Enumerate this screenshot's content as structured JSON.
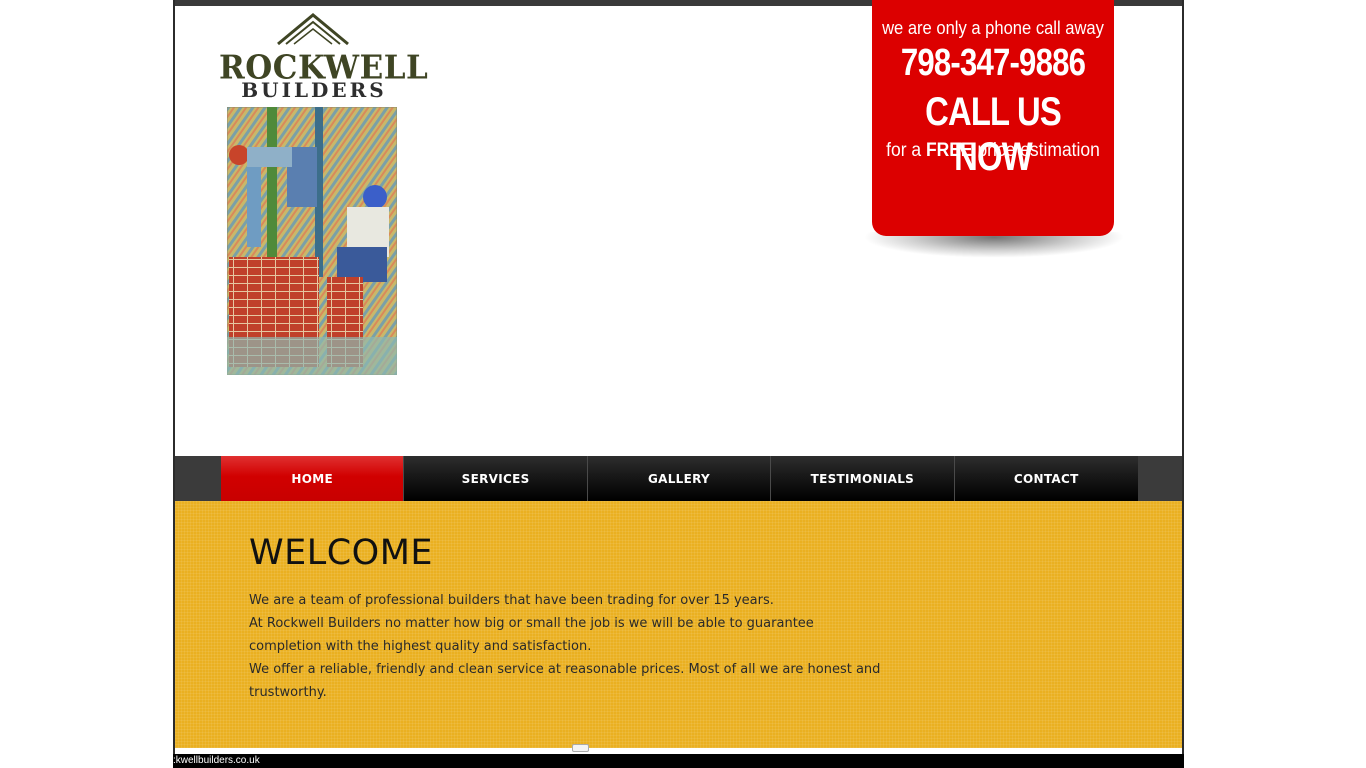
{
  "logo": {
    "line1": "ROCKWELL",
    "line2": "BUILDERS"
  },
  "callbox": {
    "line1": "we are only a phone call away",
    "phone": "798-347-9886",
    "cta": "CALL US NOW",
    "line4_prefix": "for a ",
    "line4_bold": "FREE",
    "line4_suffix": " price estimation",
    "color": "#dc0000"
  },
  "nav": {
    "items": [
      {
        "label": "HOME",
        "active": true
      },
      {
        "label": "SERVICES",
        "active": false
      },
      {
        "label": "GALLERY",
        "active": false
      },
      {
        "label": "TESTIMONIALS",
        "active": false
      },
      {
        "label": "CONTACT",
        "active": false
      }
    ]
  },
  "main": {
    "heading": "WELCOME",
    "paragraphs": [
      "We are a team of professional builders that have been trading for over 15 years.",
      "At Rockwell Builders no matter how big or small the job is we will be able to guarantee completion with the highest quality and satisfaction.",
      "We offer a reliable, friendly and clean service at reasonable prices. Most of all we are honest and trustworthy."
    ],
    "background": "#eab021"
  },
  "status": {
    "url": ":kwellbuilders.co.uk"
  }
}
